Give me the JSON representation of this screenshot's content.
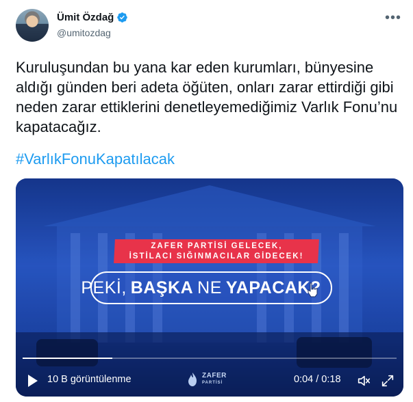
{
  "author": {
    "name": "Ümit Özdağ",
    "handle": "@umitozdag"
  },
  "tweet": {
    "text": "Kuruluşundan bu yana kar eden kurumları, bünyesine aldığı günden beri adeta öğüten, onları zarar ettirdiği gibi neden zarar ettiklerini denetleyemediğimiz Varlık Fonu’nu kapatacağız.",
    "hashtag": "#VarlıkFonuKapatılacak"
  },
  "video": {
    "banner_line1": "ZAFER PARTİSİ GELECEK,",
    "banner_line2": "İSTİLACI SIĞINMACILAR GİDECEK!",
    "pill_word1": "PEKİ,",
    "pill_word2": "BAŞKA",
    "pill_word3": "NE",
    "pill_word4": "YAPACAK?",
    "views": "10 B görüntülenme",
    "time": "0:04 / 0:18",
    "progress": 0.24,
    "logo_main": "ZAFER",
    "logo_sub": "PARTİSİ"
  },
  "colors": {
    "link": "#1d9bf0",
    "verified": "#1d9bf0",
    "banner": "#e8334a",
    "video_bg": "#2556c8"
  },
  "icons": [
    "verified-badge-icon",
    "more-options-icon",
    "play-icon",
    "volume-icon",
    "fullscreen-icon",
    "pointer-cursor-icon"
  ]
}
